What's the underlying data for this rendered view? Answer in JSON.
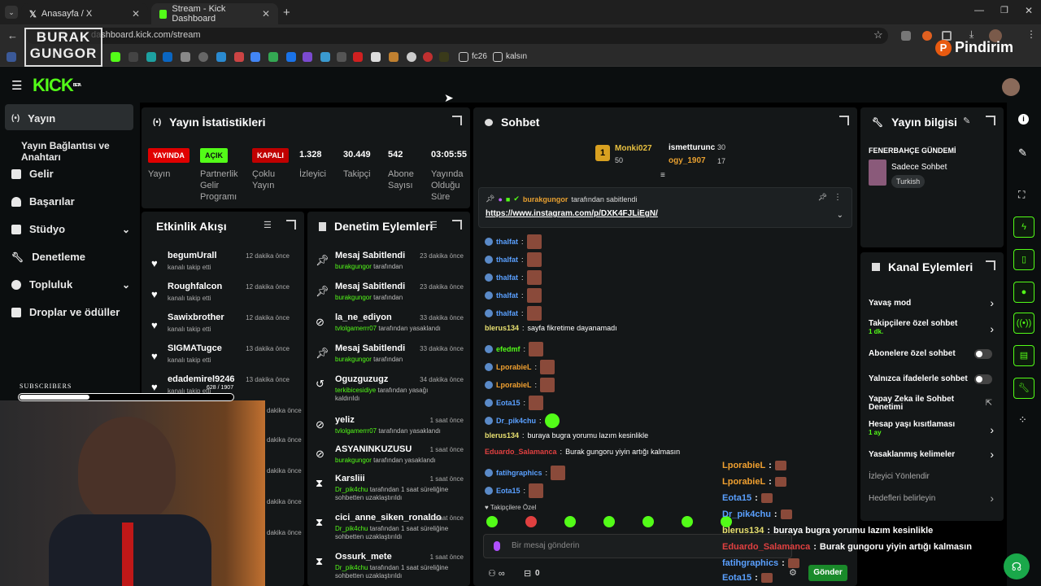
{
  "browser": {
    "tabs": [
      {
        "title": "Anasayfa / X"
      },
      {
        "title": "Stream - Kick Dashboard"
      }
    ],
    "url": "dashboard.kick.com/stream",
    "bookmarks": [
      "fc26",
      "kalsın"
    ]
  },
  "overlays": {
    "streamer_logo_top": "BURAK",
    "streamer_logo_bottom": "GUNGOR",
    "sponsor": "Pindirim",
    "subscribers_label": "SUBSCRIBERS",
    "subscribers_count": "628 / 1907",
    "subscribers_progress": 0.33
  },
  "app": {
    "logo": "KICK",
    "logo_tag": "BETA"
  },
  "sidebar": {
    "items": [
      {
        "label": "Yayın",
        "icon": "broadcast-icon"
      },
      {
        "label": "Yayın Bağlantısı ve Anahtarı",
        "icon": ""
      },
      {
        "label": "Gelir",
        "icon": "chart-icon"
      },
      {
        "label": "Başarılar",
        "icon": "trophy-icon"
      },
      {
        "label": "Stüdyo",
        "icon": "studio-icon"
      },
      {
        "label": "Denetleme",
        "icon": "wrench-icon"
      },
      {
        "label": "Topluluk",
        "icon": "people-icon"
      },
      {
        "label": "Droplar ve ödüller",
        "icon": "gift-icon"
      }
    ]
  },
  "stats": {
    "title": "Yayın İstatistikleri",
    "badges": [
      {
        "text": "YAYINDA",
        "label": "Yayın"
      },
      {
        "text": "AÇIK",
        "label": "Partnerlik Gelir Programı"
      },
      {
        "text": "KAPALI",
        "label": "Çoklu Yayın"
      }
    ],
    "numbers": [
      {
        "value": "1.328",
        "label": "İzleyici"
      },
      {
        "value": "30.449",
        "label": "Takipçi"
      },
      {
        "value": "542",
        "label": "Abone Sayısı"
      },
      {
        "value": "03:05:55",
        "label": "Yayında Olduğu Süre"
      }
    ]
  },
  "activity": {
    "title": "Etkinlik Akışı",
    "rows": [
      {
        "name": "begumUrall",
        "sub": "kanalı takip etti",
        "time": "12 dakika önce"
      },
      {
        "name": "Roughfalcon",
        "sub": "kanalı takip etti",
        "time": "12 dakika önce"
      },
      {
        "name": "Sawixbrother",
        "sub": "kanalı takip etti",
        "time": "12 dakika önce"
      },
      {
        "name": "SIGMATugce",
        "sub": "kanalı takip etti",
        "time": "13 dakika önce"
      },
      {
        "name": "edademirel9246",
        "sub": "kanalı takip etti",
        "time": "13 dakika önce"
      }
    ],
    "hidden_times": [
      "dakika önce",
      "dakika önce",
      "dakika önce",
      "dakika önce",
      "dakika önce"
    ]
  },
  "moderation": {
    "title": "Denetim Eylemleri",
    "rows": [
      {
        "icon": "pin-icon",
        "name": "Mesaj Sabitlendi",
        "actor": "burakgungor",
        "rest": " tarafından",
        "time": "23 dakika önce"
      },
      {
        "icon": "pin-icon",
        "name": "Mesaj Sabitlendi",
        "actor": "burakgungor",
        "rest": " tarafından",
        "time": "23 dakika önce"
      },
      {
        "icon": "ban-icon",
        "name": "la_ne_ediyon",
        "actor": "tvlolgamerrr07",
        "rest": " tarafından yasaklandı",
        "time": "33 dakika önce"
      },
      {
        "icon": "pin-icon",
        "name": "Mesaj Sabitlendi",
        "actor": "burakgungor",
        "rest": " tarafından",
        "time": "33 dakika önce"
      },
      {
        "icon": "undo-icon",
        "name": "Oguzguzugz",
        "actor": "terkibicesidiye",
        "rest": " tarafından yasağı kaldırıldı",
        "time": "34 dakika önce"
      },
      {
        "icon": "ban-icon",
        "name": "yeliz",
        "actor": "tvlolgamerrr07",
        "rest": " tarafından yasaklandı",
        "time": "1 saat önce"
      },
      {
        "icon": "ban-icon",
        "name": "ASYANINKUZUSU",
        "actor": "burakgungor",
        "rest": " tarafından yasaklandı",
        "time": "1 saat önce"
      },
      {
        "icon": "hourglass-icon",
        "name": "Karsliii",
        "actor": "Dr_pik4chu",
        "rest": " tarafından 1 saat süreliğine sohbetten uzaklaştırıldı",
        "time": "1 saat önce"
      },
      {
        "icon": "hourglass-icon",
        "name": "cici_anne_siken_ronaldo",
        "actor": "Dr_pik4chu",
        "rest": " tarafından 1 saat süreliğine sohbetten uzaklaştırıldı",
        "time": "1 saat önce"
      },
      {
        "icon": "hourglass-icon",
        "name": "Ossurk_mete",
        "actor": "Dr_pik4chu",
        "rest": " tarafından 1 saat süreliğine sohbetten uzaklaştırıldı",
        "time": "1 saat önce"
      }
    ]
  },
  "chat": {
    "title": "Sohbet",
    "leaderboard": [
      {
        "rank": "1",
        "name": "Monki027",
        "score": "50"
      },
      {
        "name": "ismetturunc",
        "score": "30"
      },
      {
        "name": "ogy_1907",
        "score": "17"
      }
    ],
    "pinned": {
      "by": "burakgungor",
      "by_suffix": "tarafından sabitlendi",
      "link": "https://www.instagram.com/p/DXK4FJLiEgN/"
    },
    "messages": [
      {
        "user": "thalfat",
        "text": "",
        "color": "#5aa0ff",
        "emote": true
      },
      {
        "user": "thalfat",
        "text": "",
        "color": "#5aa0ff",
        "emote": true
      },
      {
        "user": "thalfat",
        "text": "",
        "color": "#5aa0ff",
        "emote": true
      },
      {
        "user": "thalfat",
        "text": "",
        "color": "#5aa0ff",
        "emote": true
      },
      {
        "user": "thalfat",
        "text": "",
        "color": "#5aa0ff",
        "emote": true
      },
      {
        "user": "blerus134",
        "text": "sayfa fikretime dayanamadı",
        "color": "#e8e070",
        "emote": false
      },
      {
        "user": "efedmf",
        "text": "",
        "color": "#53fc18",
        "emote": true
      },
      {
        "user": "LporabieL",
        "text": "",
        "color": "#f0a030",
        "emote": true
      },
      {
        "user": "LporabieL",
        "text": "",
        "color": "#f0a030",
        "emote": true
      },
      {
        "user": "Eota15",
        "text": "",
        "color": "#5aa0ff",
        "emote": true
      },
      {
        "user": "Dr_pik4chu",
        "text": "",
        "color": "#5aa0ff",
        "emote": true
      },
      {
        "user": "blerus134",
        "text": "buraya bugra yorumu lazım kesinlikle",
        "color": "#e8e070",
        "emote": false
      },
      {
        "user": "Eduardo_Salamanca",
        "text": "Burak gungoru yiyin artığı kalmasın",
        "color": "#e04040",
        "emote": false
      },
      {
        "user": "fatihgraphics",
        "text": "",
        "color": "#5aa0ff",
        "emote": true
      },
      {
        "user": "Eota15",
        "text": "",
        "color": "#5aa0ff",
        "emote": true
      }
    ],
    "follower_label": "Takipçilere Özel",
    "input_placeholder": "Bir mesaj gönderin",
    "gift_count": "0",
    "send_label": "Gönder"
  },
  "info": {
    "title": "Yayın bilgisi",
    "stream_title": "FENERBAHÇE GÜNDEMİ",
    "category": "Sadece Sohbet",
    "tag": "Turkish"
  },
  "channel_actions": {
    "title": "Kanal Eylemleri",
    "items": [
      {
        "label": "Yavaş mod",
        "sub": "",
        "control": "chevron"
      },
      {
        "label": "Takipçilere özel sohbet",
        "sub": "1 dk.",
        "control": "chevron"
      },
      {
        "label": "Abonelere özel sohbet",
        "sub": "",
        "control": "toggle"
      },
      {
        "label": "Yalnızca ifadelerle sohbet",
        "sub": "",
        "control": "toggle"
      },
      {
        "label": "Yapay Zeka ile Sohbet Denetimi",
        "sub": "",
        "control": "external"
      },
      {
        "label": "Hesap yaşı kısıtlaması",
        "sub": "1 ay",
        "control": "chevron"
      },
      {
        "label": "Yasaklanmış kelimeler",
        "sub": "",
        "control": "chevron"
      },
      {
        "label": "İzleyici Yönlendir",
        "sub": "",
        "control": "none"
      },
      {
        "label": "Hedefleri belirleyin",
        "sub": "",
        "control": "chevron"
      }
    ]
  },
  "chat_overlay": [
    {
      "user": "LporabieL",
      "text": "",
      "color": "#f0a030"
    },
    {
      "user": "LporabieL",
      "text": "",
      "color": "#f0a030"
    },
    {
      "user": "Eota15",
      "text": "",
      "color": "#5aa0ff"
    },
    {
      "user": "Dr_pik4chu",
      "text": "",
      "color": "#5aa0ff"
    },
    {
      "user": "blerus134",
      "text": "buraya bugra yorumu lazım kesinlikle",
      "color": "#e8e070"
    },
    {
      "user": "Eduardo_Salamanca",
      "text": "Burak gungoru yiyin artığı kalmasın",
      "color": "#e04040"
    },
    {
      "user": "fatihgraphics",
      "text": "",
      "color": "#5aa0ff"
    },
    {
      "user": "Eota15",
      "text": "",
      "color": "#5aa0ff"
    }
  ],
  "colors": {
    "kick_green": "#53fc18",
    "bg": "#0b0e0f",
    "panel": "#141718",
    "live_red": "#e00000"
  }
}
